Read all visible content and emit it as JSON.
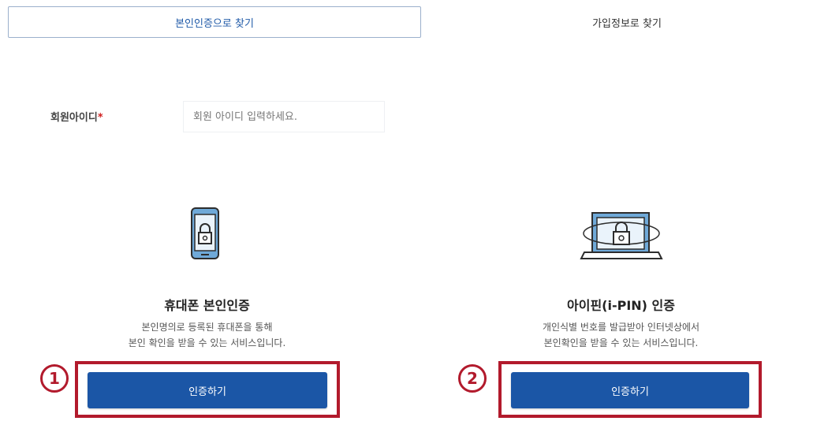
{
  "tabs": {
    "identity": "본인인증으로 찾기",
    "signup_info": "가입정보로 찾기"
  },
  "member_id": {
    "label": "회원아이디",
    "required_mark": "*",
    "placeholder": "회원 아이디 입력하세요."
  },
  "phone_auth": {
    "icon": "mobile-lock-icon",
    "title": "휴대폰 본인인증",
    "desc_line1": "본인명의로 등록된 휴대폰을 통해",
    "desc_line2": "본인 확인을 받을 수 있는 서비스입니다.",
    "button": "인증하기",
    "marker": "1"
  },
  "ipin_auth": {
    "icon": "laptop-lock-icon",
    "title": "아이핀(i-PIN) 인증",
    "desc_line1": "개인식별 번호를 발급받아 인터넷상에서",
    "desc_line2": "본인확인을 받을 수 있는 서비스입니다.",
    "button": "인증하기",
    "marker": "2"
  },
  "colors": {
    "primary": "#1b56a6",
    "highlight": "#b21a2c",
    "tab_border": "#9bb0cc",
    "icon_fill": "#6fa9d8"
  }
}
